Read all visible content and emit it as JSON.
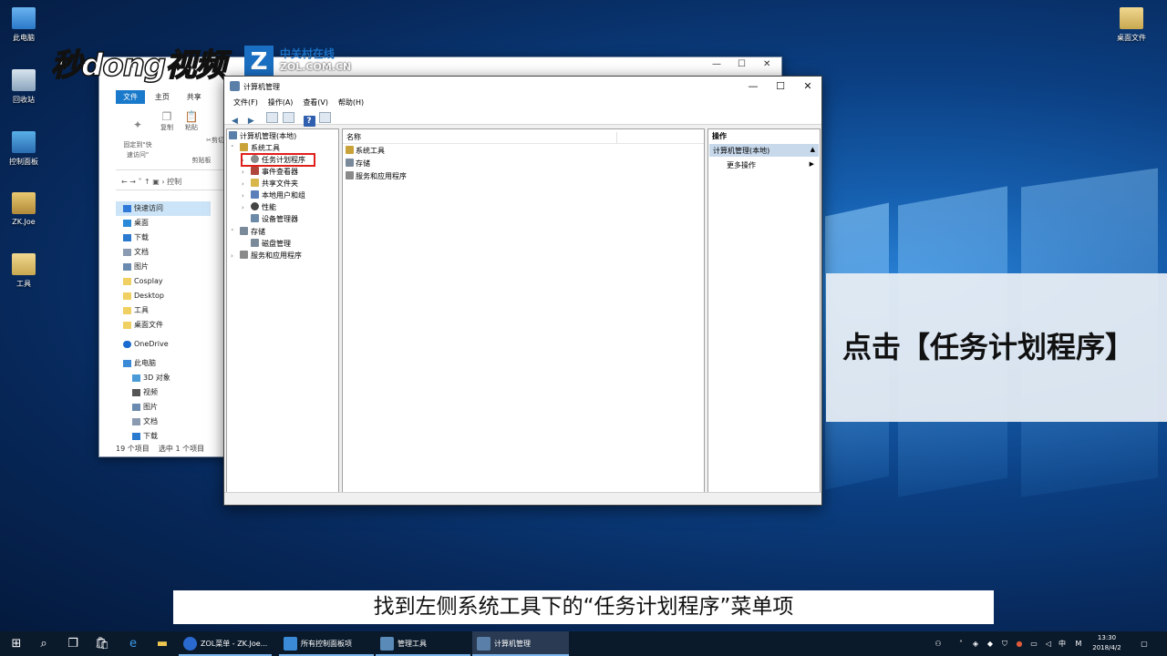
{
  "desktop": {
    "icons": [
      {
        "label": "此电脑"
      },
      {
        "label": "回收站"
      },
      {
        "label": "控制面板"
      },
      {
        "label": "ZK.Joe"
      },
      {
        "label": "工具"
      },
      {
        "label": "桌面文件"
      }
    ]
  },
  "watermark": {
    "logo": "秒dong视频",
    "zol_cn": "中关村在线",
    "zol_en": "ZOL.COM.CN"
  },
  "explorer": {
    "tabs": [
      "文件",
      "主页",
      "共享"
    ],
    "ribbon": {
      "pin": "固定到\"快\n速访问\"",
      "copy": "复制",
      "paste": "粘贴",
      "cut": "剪切",
      "clipboard": "剪贴板"
    },
    "address": "控制",
    "nav": [
      {
        "label": "快速访问"
      },
      {
        "label": "桌面"
      },
      {
        "label": "下载"
      },
      {
        "label": "文档"
      },
      {
        "label": "图片"
      },
      {
        "label": "Cosplay"
      },
      {
        "label": "Desktop"
      },
      {
        "label": "工具"
      },
      {
        "label": "桌面文件"
      },
      {
        "label": "OneDrive"
      },
      {
        "label": "此电脑"
      },
      {
        "label": "3D 对象"
      },
      {
        "label": "视频"
      },
      {
        "label": "图片"
      },
      {
        "label": "文档"
      },
      {
        "label": "下载"
      }
    ],
    "status_items": "19 个项目",
    "status_selected": "选中 1 个项目"
  },
  "mmc": {
    "title": "计算机管理",
    "menu": [
      "文件(F)",
      "操作(A)",
      "查看(V)",
      "帮助(H)"
    ],
    "tree": [
      {
        "label": "计算机管理(本地)",
        "color": "#5a7fa8"
      },
      {
        "label": "系统工具",
        "color": "#c9a33a"
      },
      {
        "label": "任务计划程序",
        "color": "#8a8a8a"
      },
      {
        "label": "事件查看器",
        "color": "#b0463b"
      },
      {
        "label": "共享文件夹",
        "color": "#d8b64a"
      },
      {
        "label": "本地用户和组",
        "color": "#5b7fb8"
      },
      {
        "label": "性能",
        "color": "#444444"
      },
      {
        "label": "设备管理器",
        "color": "#6a8aa8"
      },
      {
        "label": "存储",
        "color": "#7a8a9a"
      },
      {
        "label": "磁盘管理",
        "color": "#7a8a9a"
      },
      {
        "label": "服务和应用程序",
        "color": "#8a8a8a"
      }
    ],
    "column_header": "名称",
    "list": [
      {
        "label": "系统工具",
        "color": "#c9a33a"
      },
      {
        "label": "存储",
        "color": "#7a8a9a"
      },
      {
        "label": "服务和应用程序",
        "color": "#8a8a8a"
      }
    ],
    "actions": {
      "header": "操作",
      "section": "计算机管理(本地)",
      "more": "更多操作"
    }
  },
  "overlay_caption": "点击【任务计划程序】",
  "subtitle": "找到左侧系统工具下的“任务计划程序”菜单项",
  "taskbar": {
    "apps": [
      {
        "label": "ZOL菜单 - ZK.Joe..."
      },
      {
        "label": "所有控制面板项"
      },
      {
        "label": "管理工具"
      },
      {
        "label": "计算机管理"
      }
    ],
    "tray_ime": "中",
    "tray_m": "M",
    "time": "13:30",
    "date": "2018/4/2"
  }
}
